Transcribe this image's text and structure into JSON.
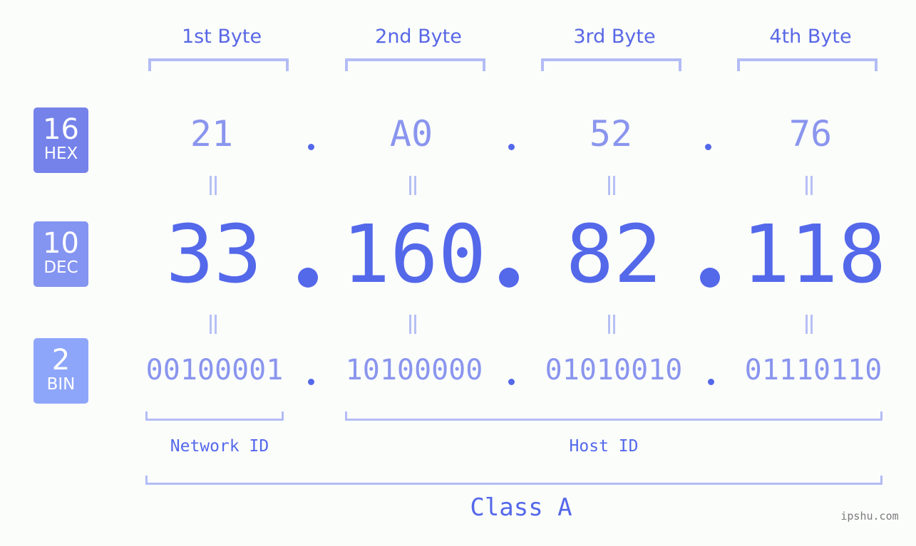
{
  "ip": {
    "bytes": [
      {
        "header": "1st Byte",
        "hex": "21",
        "dec": "33",
        "bin": "00100001"
      },
      {
        "header": "2nd Byte",
        "hex": "A0",
        "dec": "160",
        "bin": "10100000"
      },
      {
        "header": "3rd Byte",
        "hex": "52",
        "dec": "82",
        "bin": "01010010"
      },
      {
        "header": "4th Byte",
        "hex": "76",
        "dec": "118",
        "bin": "01110110"
      }
    ]
  },
  "badges": {
    "hex": {
      "base": "16",
      "label": "HEX",
      "color": "#7582ea"
    },
    "dec": {
      "base": "10",
      "label": "DEC",
      "color": "#8494f1"
    },
    "bin": {
      "base": "2",
      "label": "BIN",
      "color": "#8ea6f9"
    }
  },
  "segments": {
    "network_id": "Network ID",
    "host_id": "Host ID",
    "class": "Class A"
  },
  "colors": {
    "accent": "#5468ea",
    "bracket": "#b3bcf6",
    "light_value": "#8a95ee",
    "background": "#fbfdfb"
  },
  "brand": "ipshu.com"
}
